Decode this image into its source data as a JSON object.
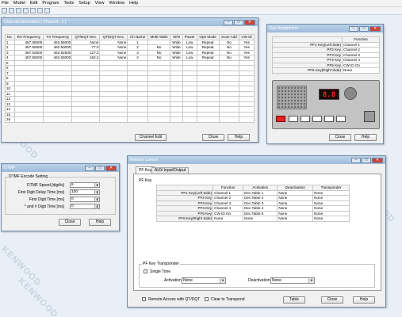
{
  "watermark": "KENWOOD",
  "menu": [
    "File",
    "Model",
    "Edit",
    "Program",
    "Tools",
    "Setup",
    "View",
    "Window",
    "Help"
  ],
  "channel_window": {
    "title": "Channel Information ( Channel - 1 )",
    "columns": [
      "No.",
      "RX Frequency",
      "TX Frequency",
      "QT/DQT Dec.",
      "QT/DQT Enc.",
      "Ch Name",
      "Multi-Table",
      "W/N",
      "Power",
      "Ope Mode",
      "Scan Add",
      "CW ID"
    ],
    "rows": [
      [
        "1",
        "467.55000",
        "462.55000",
        "None",
        "None",
        "1",
        "",
        "Wide",
        "Low",
        "Repeat",
        "No",
        "Yes"
      ],
      [
        "2",
        "467.50000",
        "462.50000",
        "77.0",
        "None",
        "2",
        "No",
        "Wide",
        "Low",
        "Repeat",
        "No",
        "Yes"
      ],
      [
        "3",
        "467.52500",
        "462.52500",
        "127.3",
        "None",
        "3",
        "No",
        "Wide",
        "Low",
        "Repeat",
        "No",
        "Yes"
      ],
      [
        "4",
        "467.55000",
        "462.55000",
        "162.2",
        "None",
        "4",
        "No",
        "Wide",
        "Low",
        "Repeat",
        "No",
        "Yes"
      ],
      [
        "5"
      ],
      [
        "6"
      ],
      [
        "7"
      ],
      [
        "8"
      ],
      [
        "9"
      ],
      [
        "10"
      ],
      [
        "11"
      ],
      [
        "12"
      ],
      [
        "13"
      ],
      [
        "14"
      ],
      [
        "15"
      ],
      [
        "16"
      ]
    ],
    "buttons": {
      "edit": "Channel Edit",
      "close": "Close",
      "help": "Help"
    }
  },
  "key_window": {
    "title": "Key Assignment",
    "header": "Function",
    "rows": [
      [
        "PF1 Key(Left Side)",
        "Channel 1"
      ],
      [
        "PF2 Key",
        "Channel 2"
      ],
      [
        "PF3 Key",
        "Channel 3"
      ],
      [
        "PF4 Key",
        "Channel 4"
      ],
      [
        "PF5 Key",
        "CW ID On"
      ],
      [
        "PF6 Key(Right Side)",
        "None"
      ]
    ],
    "display": "8.8",
    "buttons": {
      "close": "Close",
      "help": "Help"
    }
  },
  "dtmf_window": {
    "title": "DTMF",
    "group": "DTMF Encode Setting",
    "fields": [
      {
        "label": "DTMF Speed [digit/s]",
        "value": "6"
      },
      {
        "label": "First Digit Delay Time [ms]",
        "value": "100"
      },
      {
        "label": "First Digit Time [ms]",
        "value": "0"
      },
      {
        "label": "* and # Digit Time [ms]",
        "value": "0"
      }
    ],
    "buttons": {
      "close": "Close",
      "help": "Help"
    }
  },
  "remote_window": {
    "title": "Remote Control",
    "tabs": [
      "PF Key",
      "AUX Input/Output"
    ],
    "group": "PF Key",
    "columns": [
      "",
      "Function",
      "Activation",
      "Deactivation",
      "Transponder"
    ],
    "rows": [
      [
        "PF1 Key(Left Side)",
        "Channel 1",
        "Dec.Table 1",
        "None",
        "None"
      ],
      [
        "PF2 Key",
        "Channel 2",
        "Dec.Table 2",
        "None",
        "None"
      ],
      [
        "PF3 Key",
        "Channel 3",
        "Dec.Table 3",
        "None",
        "None"
      ],
      [
        "PF4 Key",
        "Channel 4",
        "Dec.Table 4",
        "None",
        "None"
      ],
      [
        "PF5 Key",
        "CW ID On",
        "Dec.Table 5",
        "None",
        "None"
      ],
      [
        "PF6 Key(Right Side)",
        "None",
        "None",
        "None",
        "None"
      ]
    ],
    "transponder_group": "PF Key Transponder",
    "single_tone": "Single Tone",
    "activation_label": "Activation",
    "activation_value": "None",
    "deactivation_label": "Deactivation",
    "deactivation_value": "None",
    "remote_access": "Remote Access with QT/DQT",
    "clear_transpond": "Clear to Transpond",
    "buttons": {
      "table": "Table",
      "close": "Close",
      "help": "Help"
    }
  }
}
